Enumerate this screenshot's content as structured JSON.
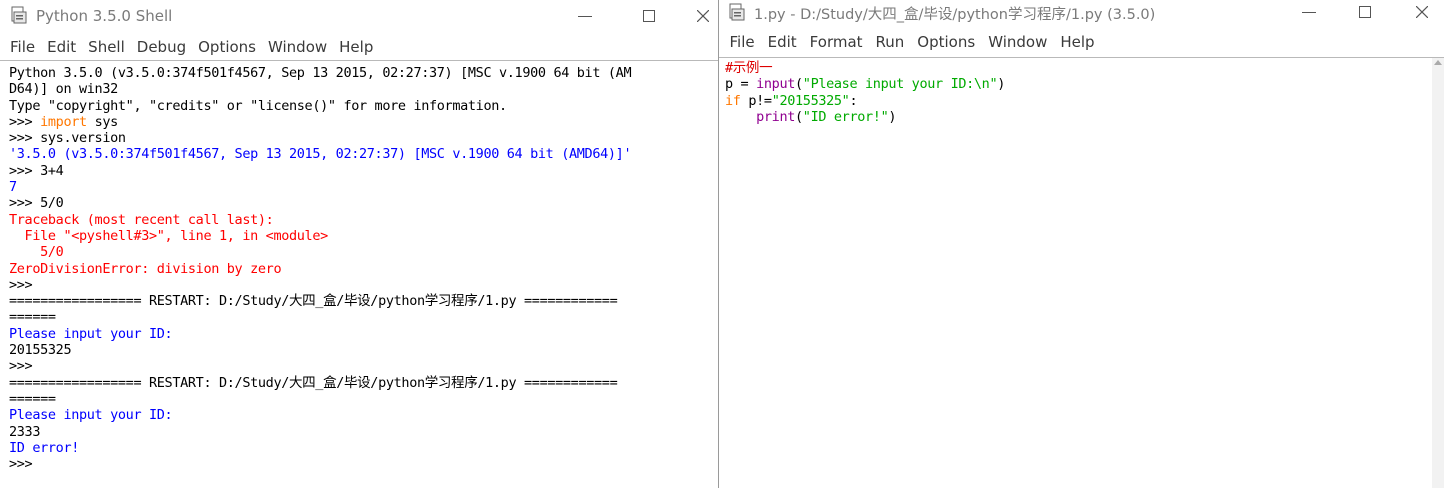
{
  "shell": {
    "title": "Python 3.5.0 Shell",
    "menu": [
      "File",
      "Edit",
      "Shell",
      "Debug",
      "Options",
      "Window",
      "Help"
    ],
    "lines": [
      [
        {
          "t": "Python 3.5.0 (v3.5.0:374f501f4567, Sep 13 2015, 02:27:37) [MSC v.1900 64 bit (AM",
          "c": "plain"
        }
      ],
      [
        {
          "t": "D64)] on win32",
          "c": "plain"
        }
      ],
      [
        {
          "t": "Type \"copyright\", \"credits\" or \"license()\" for more information.",
          "c": "plain"
        }
      ],
      [
        {
          "t": ">>> ",
          "c": "plain"
        },
        {
          "t": "import",
          "c": "kw"
        },
        {
          "t": " sys",
          "c": "plain"
        }
      ],
      [
        {
          "t": ">>> sys.version",
          "c": "plain"
        }
      ],
      [
        {
          "t": "'3.5.0 (v3.5.0:374f501f4567, Sep 13 2015, 02:27:37) [MSC v.1900 64 bit (AMD64)]'",
          "c": "out"
        }
      ],
      [
        {
          "t": ">>> 3+4",
          "c": "plain"
        }
      ],
      [
        {
          "t": "7",
          "c": "out"
        }
      ],
      [
        {
          "t": ">>> 5/0",
          "c": "plain"
        }
      ],
      [
        {
          "t": "Traceback (most recent call last):",
          "c": "err"
        }
      ],
      [
        {
          "t": "  File \"<pyshell#3>\", line 1, in <module>",
          "c": "err"
        }
      ],
      [
        {
          "t": "    5/0",
          "c": "err"
        }
      ],
      [
        {
          "t": "ZeroDivisionError: division by zero",
          "c": "err"
        }
      ],
      [
        {
          "t": ">>> ",
          "c": "plain"
        }
      ],
      [
        {
          "t": "================= RESTART: D:/Study/大四_盒/毕设/python学习程序/1.py ============",
          "c": "plain"
        }
      ],
      [
        {
          "t": "======",
          "c": "plain"
        }
      ],
      [
        {
          "t": "Please input your ID:",
          "c": "out"
        }
      ],
      [
        {
          "t": "20155325",
          "c": "plain"
        }
      ],
      [
        {
          "t": ">>> ",
          "c": "plain"
        }
      ],
      [
        {
          "t": "================= RESTART: D:/Study/大四_盒/毕设/python学习程序/1.py ============",
          "c": "plain"
        }
      ],
      [
        {
          "t": "======",
          "c": "plain"
        }
      ],
      [
        {
          "t": "Please input your ID:",
          "c": "out"
        }
      ],
      [
        {
          "t": "2333",
          "c": "plain"
        }
      ],
      [
        {
          "t": "ID error!",
          "c": "out"
        }
      ],
      [
        {
          "t": ">>> ",
          "c": "plain"
        }
      ]
    ]
  },
  "editor": {
    "title": "1.py - D:/Study/大四_盒/毕设/python学习程序/1.py (3.5.0)",
    "menu": [
      "File",
      "Edit",
      "Format",
      "Run",
      "Options",
      "Window",
      "Help"
    ],
    "lines": [
      [
        {
          "t": "#示例一",
          "c": "cm"
        }
      ],
      [
        {
          "t": "p = ",
          "c": "plain"
        },
        {
          "t": "input",
          "c": "bi"
        },
        {
          "t": "(",
          "c": "plain"
        },
        {
          "t": "\"Please input your ID:\\n\"",
          "c": "str"
        },
        {
          "t": ")",
          "c": "plain"
        }
      ],
      [
        {
          "t": "if",
          "c": "kw"
        },
        {
          "t": " p!=",
          "c": "plain"
        },
        {
          "t": "\"20155325\"",
          "c": "str"
        },
        {
          "t": ":",
          "c": "plain"
        }
      ],
      [
        {
          "t": "    ",
          "c": "plain"
        },
        {
          "t": "print",
          "c": "bi"
        },
        {
          "t": "(",
          "c": "plain"
        },
        {
          "t": "\"ID error!\"",
          "c": "str"
        },
        {
          "t": ")",
          "c": "plain"
        }
      ]
    ]
  },
  "window_controls": {
    "minimize": "minimize",
    "maximize": "maximize",
    "close": "close"
  },
  "colors": {
    "keyword": "#ff7700",
    "output": "#0000ff",
    "error": "#ff0000",
    "string": "#00aa00",
    "builtin": "#900090",
    "comment": "#dd0000"
  }
}
